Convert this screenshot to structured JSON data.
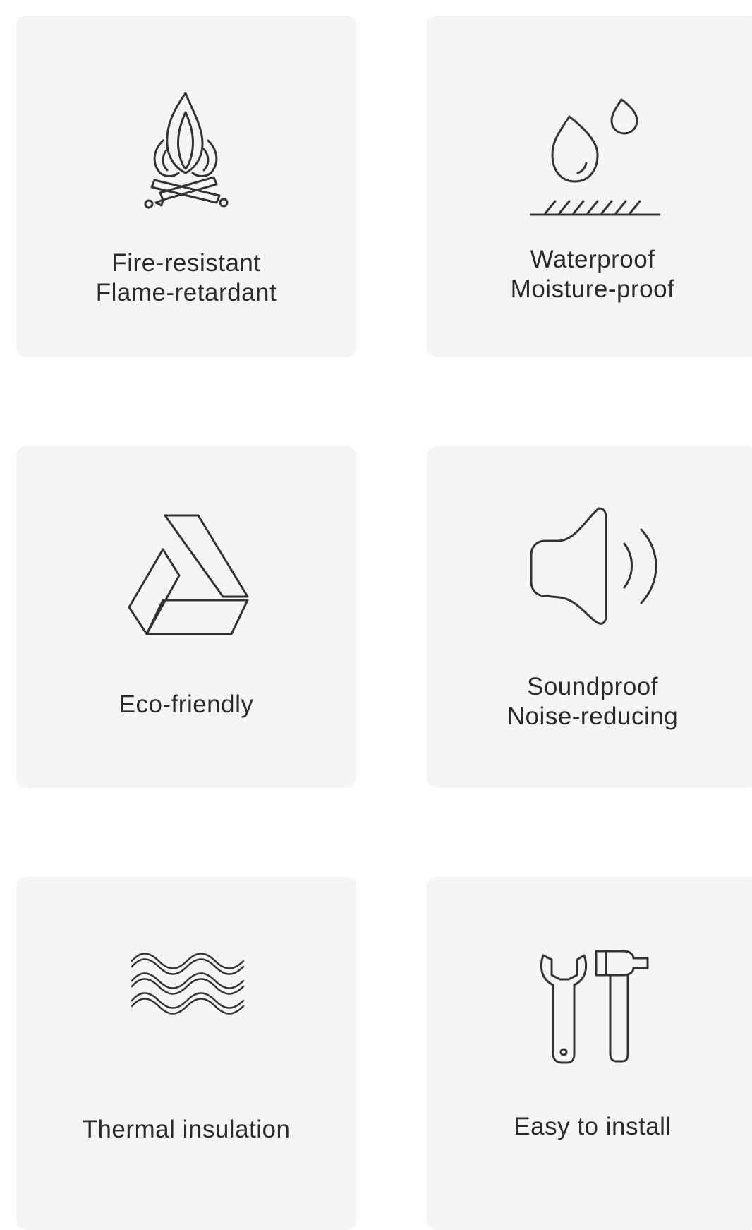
{
  "features": [
    {
      "icon": "campfire-icon",
      "lines": [
        "Fire-resistant",
        "Flame-retardant"
      ]
    },
    {
      "icon": "water-drops-icon",
      "lines": [
        "Waterproof",
        "Moisture-proof"
      ]
    },
    {
      "icon": "recycle-triangle-icon",
      "lines": [
        "Eco-friendly"
      ]
    },
    {
      "icon": "speaker-icon",
      "lines": [
        "Soundproof",
        "Noise-reducing"
      ]
    },
    {
      "icon": "heat-waves-icon",
      "lines": [
        "Thermal insulation"
      ]
    },
    {
      "icon": "wrench-hammer-icon",
      "lines": [
        "Easy to install"
      ]
    }
  ],
  "colors": {
    "card_background": "#f5f5f5",
    "icon_stroke": "#333333",
    "text": "#2a2a2a"
  }
}
